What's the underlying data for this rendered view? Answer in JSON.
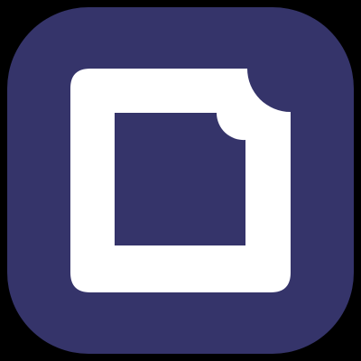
{
  "icon": {
    "name": "rounded-square-frame-with-bitten-corner",
    "background_color": "#000000",
    "tile_color": "#35346a",
    "glyph_color": "#ffffff",
    "inner_color": "#35346a"
  }
}
